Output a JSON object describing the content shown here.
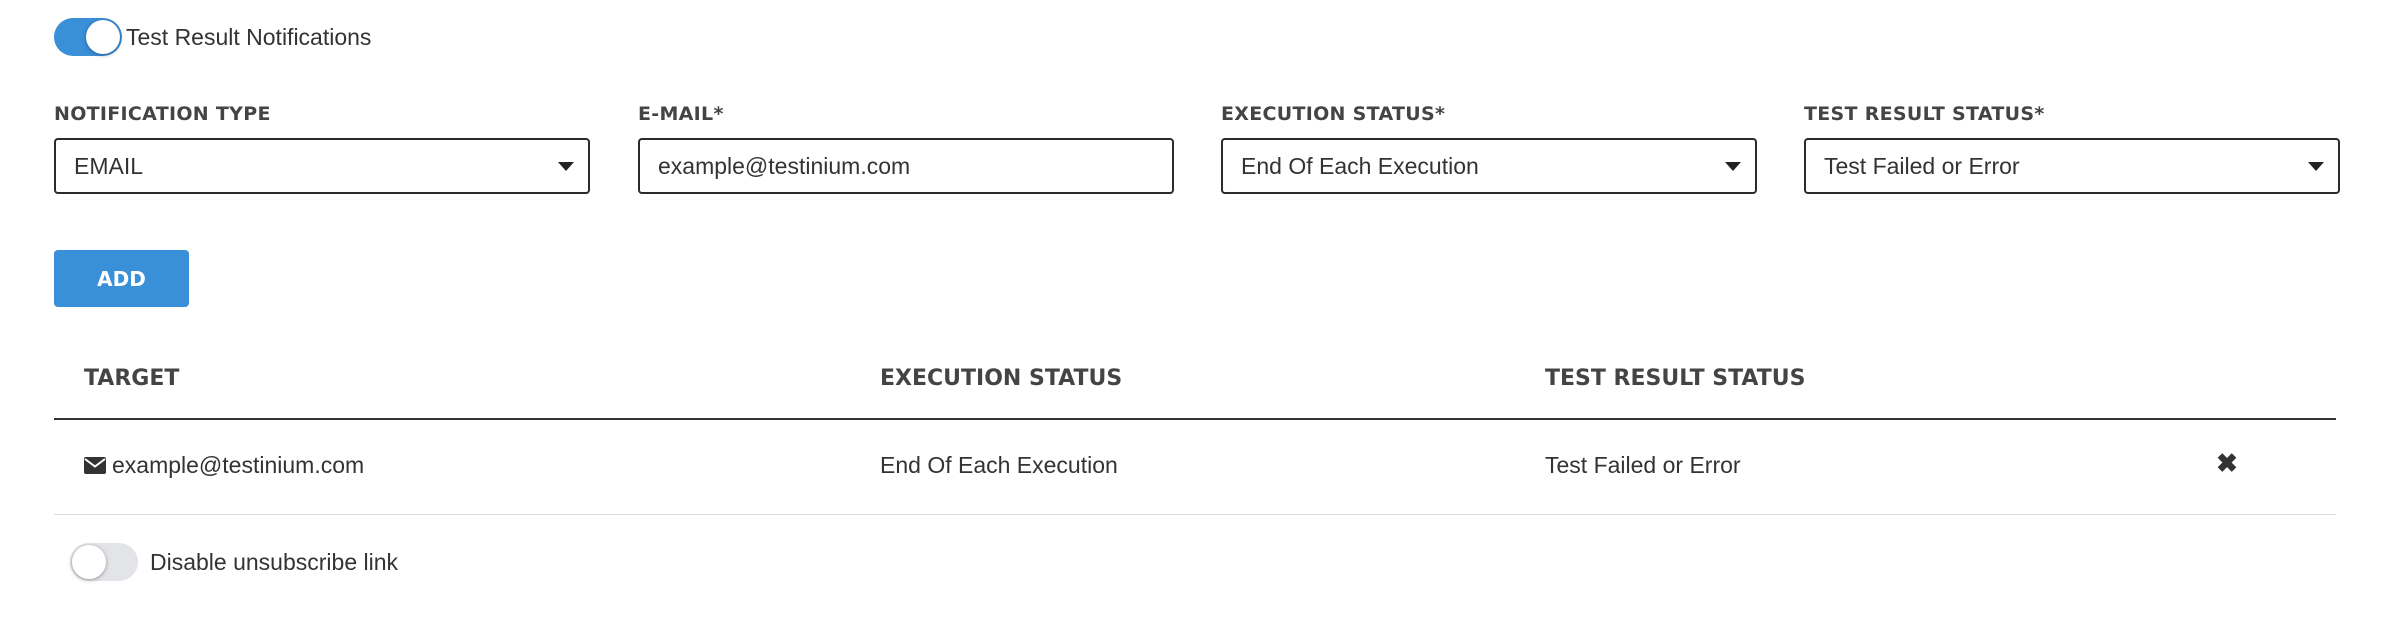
{
  "notifications_toggle": {
    "label": "Test Result Notifications",
    "enabled": true
  },
  "form": {
    "notification_type": {
      "label": "NOTIFICATION TYPE",
      "value": "EMAIL"
    },
    "email": {
      "label": "E-MAIL*",
      "value": "example@testinium.com"
    },
    "execution_status": {
      "label": "EXECUTION STATUS*",
      "value": "End Of Each Execution"
    },
    "test_result_status": {
      "label": "TEST RESULT STATUS*",
      "value": "Test Failed or Error"
    },
    "add_label": "ADD"
  },
  "table": {
    "columns": [
      "TARGET",
      "EXECUTION STATUS",
      "TEST RESULT STATUS"
    ],
    "rows": [
      {
        "target_icon": "envelope-icon",
        "target": "example@testinium.com",
        "execution_status": "End Of Each Execution",
        "test_result_status": "Test Failed or Error",
        "delete_icon": "close-icon"
      }
    ]
  },
  "unsubscribe_toggle": {
    "label": "Disable unsubscribe link",
    "enabled": false
  },
  "colors": {
    "accent": "#3a8fd9",
    "toggle_off": "#e3e4e8",
    "text": "#333333"
  }
}
